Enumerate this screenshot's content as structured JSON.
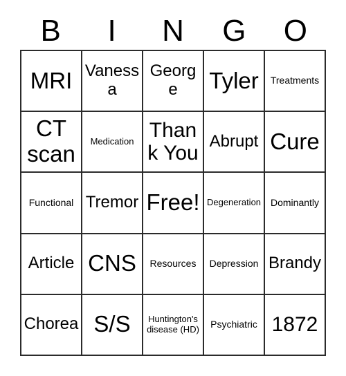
{
  "card": {
    "title_letters": [
      "B",
      "I",
      "N",
      "G",
      "O"
    ],
    "rows": [
      [
        {
          "text": "MRI",
          "size": "xl"
        },
        {
          "text": "Vanessa",
          "size": "md"
        },
        {
          "text": "George",
          "size": "md"
        },
        {
          "text": "Tyler",
          "size": "xl"
        },
        {
          "text": "Treatments",
          "size": "sm"
        }
      ],
      [
        {
          "text": "CT scan",
          "size": "xl"
        },
        {
          "text": "Medication",
          "size": "xs"
        },
        {
          "text": "Thank You",
          "size": "lg"
        },
        {
          "text": "Abrupt",
          "size": "md"
        },
        {
          "text": "Cure",
          "size": "xl"
        }
      ],
      [
        {
          "text": "Functional",
          "size": "sm"
        },
        {
          "text": "Tremor",
          "size": "md"
        },
        {
          "text": "Free!",
          "size": "xl"
        },
        {
          "text": "Degeneration",
          "size": "xs"
        },
        {
          "text": "Dominantly",
          "size": "sm"
        }
      ],
      [
        {
          "text": "Article",
          "size": "md"
        },
        {
          "text": "CNS",
          "size": "xl"
        },
        {
          "text": "Resources",
          "size": "sm"
        },
        {
          "text": "Depression",
          "size": "sm"
        },
        {
          "text": "Brandy",
          "size": "md"
        }
      ],
      [
        {
          "text": "Chorea",
          "size": "md"
        },
        {
          "text": "S/S",
          "size": "xl"
        },
        {
          "text": "Huntington's disease (HD)",
          "size": "xs"
        },
        {
          "text": "Psychiatric",
          "size": "sm"
        },
        {
          "text": "1872",
          "size": "lg"
        }
      ]
    ],
    "colors": {
      "background": "#ffffff",
      "text": "#000000",
      "grid_line": "#2b2b2b"
    }
  }
}
